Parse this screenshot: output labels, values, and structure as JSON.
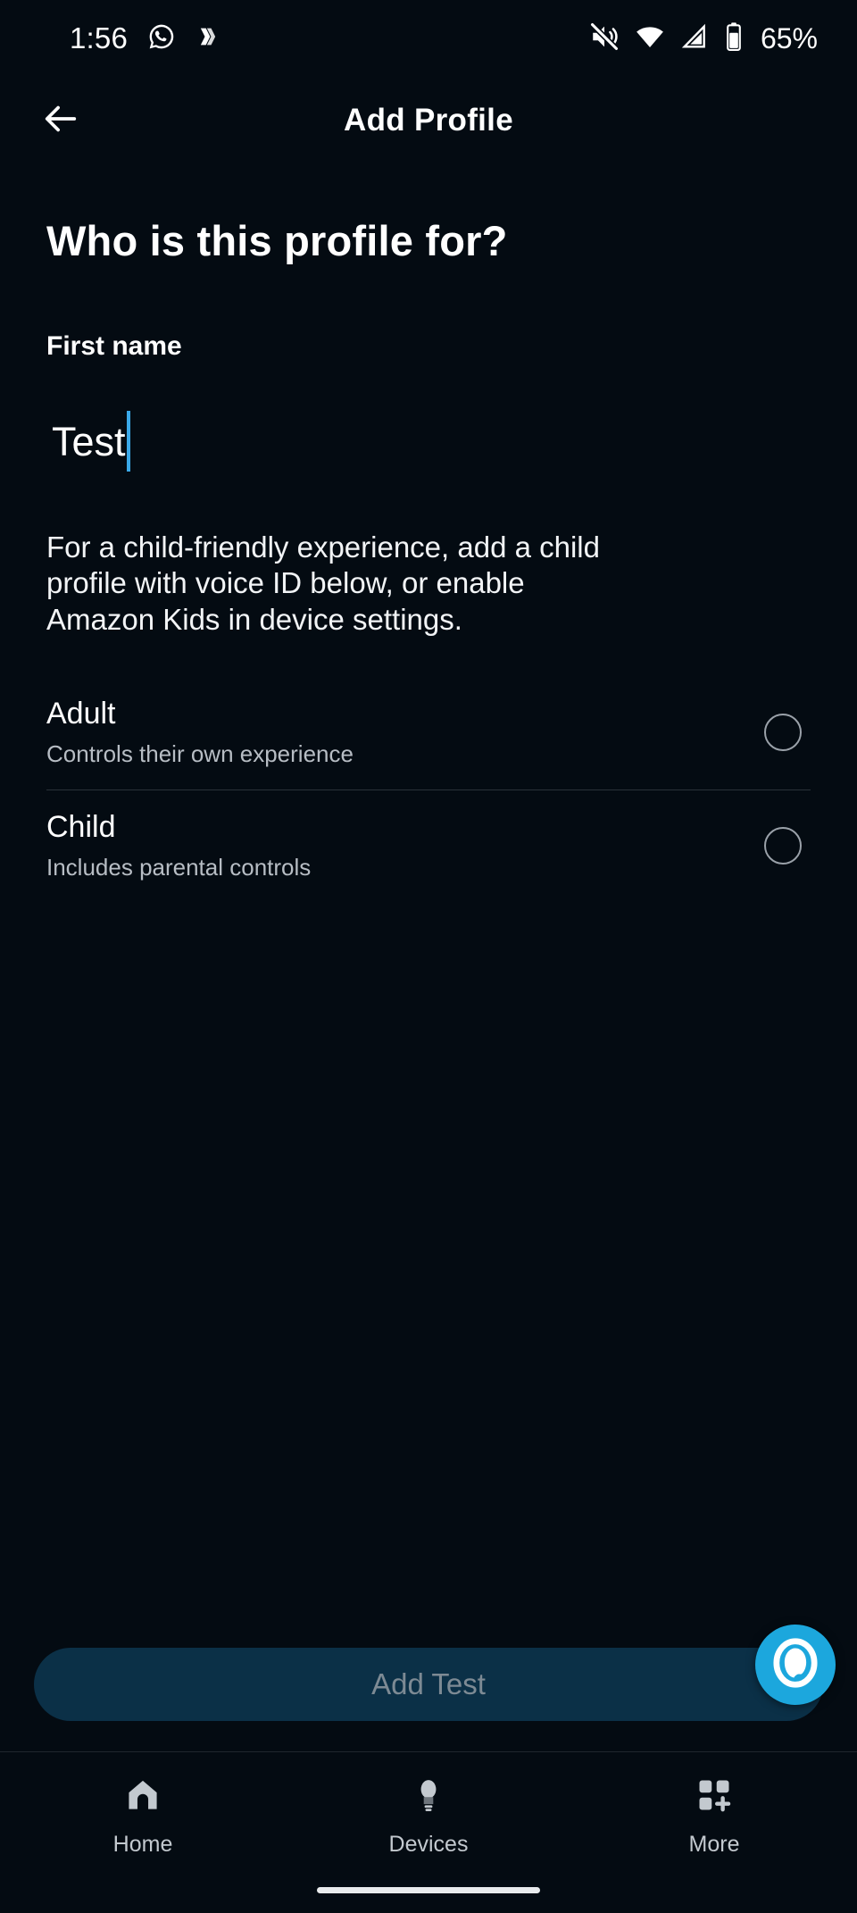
{
  "status_bar": {
    "time": "1:56",
    "battery_text": "65%",
    "icons_left": [
      "whatsapp-icon",
      "app-notification-icon"
    ],
    "icons_right": [
      "volume-off-icon",
      "wifi-icon",
      "cellular-signal-icon",
      "battery-icon"
    ]
  },
  "app_bar": {
    "back_icon": "back-arrow-icon",
    "title": "Add Profile"
  },
  "main": {
    "heading": "Who is this profile for?",
    "first_name": {
      "label": "First name",
      "value": "Test",
      "placeholder": "First name"
    },
    "helper_text": "For a child-friendly experience, add a child profile with voice ID below, or enable Amazon Kids in device settings.",
    "options": [
      {
        "title": "Adult",
        "subtitle": "Controls their own experience",
        "selected": false
      },
      {
        "title": "Child",
        "subtitle": "Includes parental controls",
        "selected": false
      }
    ]
  },
  "bottom_action": {
    "primary_label": "Add Test",
    "assistant_icon": "alexa-icon"
  },
  "bottom_nav": {
    "items": [
      {
        "label": "Home",
        "icon": "home-icon"
      },
      {
        "label": "Devices",
        "icon": "lightbulb-icon"
      },
      {
        "label": "More",
        "icon": "grid-plus-icon"
      }
    ]
  },
  "colors": {
    "background": "#040b12",
    "accent_cyan": "#1ca7dd",
    "caret_blue": "#3aa8e8",
    "button_disabled_bg": "#0b3047",
    "button_disabled_text": "#7d8a94",
    "muted_text": "#b7bdc4"
  }
}
